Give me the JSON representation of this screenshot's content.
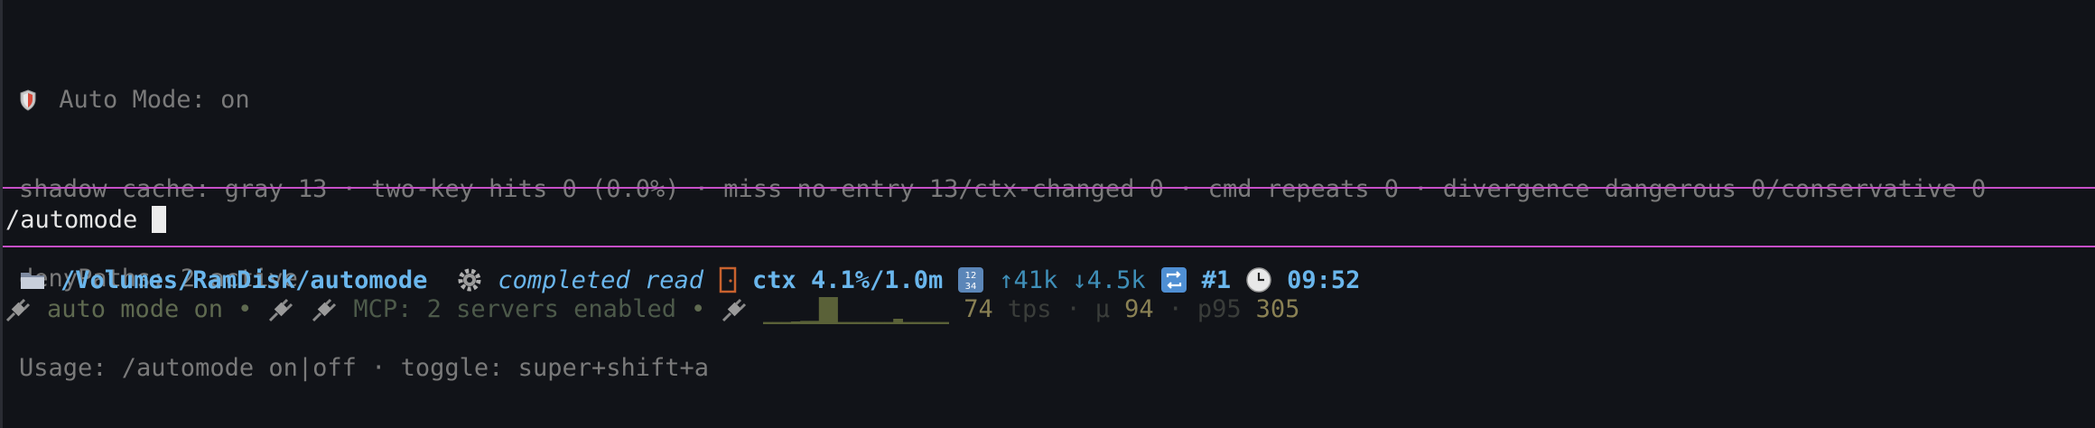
{
  "colors": {
    "background": "#111318",
    "rule": "#c64fc7",
    "path": "#6ab6ec",
    "footer_text": "#5f6a50",
    "sparkline": "#5a6138"
  },
  "info": {
    "auto_mode_line": "Auto Mode: on",
    "shadow_cache_line": "shadow cache: gray 13 · two-key hits 0 (0.0%) · miss no-entry 13/ctx-changed 0 · cmd repeats 0 · divergence dangerous 0/conservative 0",
    "deny_paths_line": "denyPaths: 2 active",
    "usage_line": "Usage: /automode on|off · toggle: super+shift+a"
  },
  "prompt": {
    "input_value": "/automode"
  },
  "status": {
    "folder_icon": "folder-icon",
    "path": "/Volumes/RamDisk/automode",
    "gear_icon": "gear-icon",
    "activity": "completed read",
    "door_icon": "door-icon",
    "ctx": "ctx 4.1%/1.0m",
    "numbers_icon": "numbers-icon",
    "tokens_up": "↑41k",
    "tokens_down": "↓4.5k",
    "repeat_icon": "repeat-icon",
    "turn": "#1",
    "clock_icon": "clock-icon",
    "time": "09:52"
  },
  "footer": {
    "plug_icon": "plug-icon",
    "auto_mode": "auto mode on",
    "bullet": "•",
    "mcp": "MCP: 2 servers enabled",
    "tps_value": "74",
    "tps_label": "tps",
    "sep": "·",
    "mu_label": "μ",
    "mu_value": "94",
    "p95_label": "p95",
    "p95_value": "305",
    "sparkline_values": [
      0.08,
      0.08,
      0.08,
      0.1,
      0.12,
      0.12,
      1.0,
      1.0,
      0.08,
      0.08,
      0.08,
      0.08,
      0.08,
      0.08,
      0.2,
      0.08,
      0.08,
      0.08,
      0.08,
      0.08
    ]
  }
}
